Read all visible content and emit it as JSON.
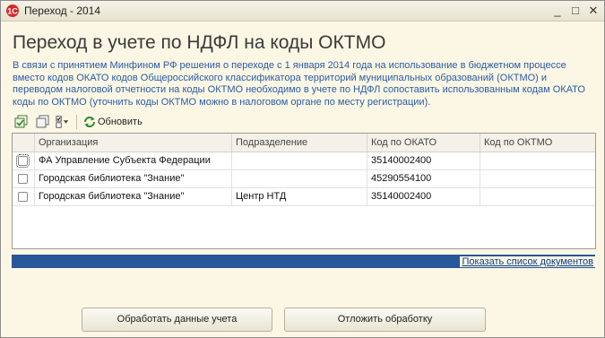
{
  "window": {
    "title": "Переход - 2014",
    "controls": {
      "minimize": "_",
      "maximize": "□",
      "close": "✕"
    }
  },
  "page": {
    "title": "Переход в учете по НДФЛ на коды ОКТМО",
    "info_lines": [
      "В связи с принятием Минфином РФ решения о переходе с 1 января 2014 года на использование в бюджетном процессе",
      "вместо кодов ОКАТО кодов Общероссийского классификатора территорий муниципальных образований (ОКТМО) и",
      "переводом налоговой отчетности на коды ОКТМО необходимо в учете по НДФЛ сопоставить использованным кодам ОКАТО",
      "коды по ОКТМО (уточнить коды ОКТМО можно в налоговом органе по месту регистрации)."
    ]
  },
  "toolbar": {
    "icons": [
      "select-all-icon",
      "deselect-all-icon",
      "checklist-menu-icon"
    ],
    "refresh_label": "Обновить"
  },
  "table": {
    "columns": [
      "",
      "Организация",
      "Подразделение",
      "Код по ОКАТО",
      "Код по ОКТМО"
    ],
    "rows": [
      {
        "checked": false,
        "organization": "ФА Управление Субъекта Федерации",
        "subdivision": "",
        "okato": "35140002400",
        "oktmo": ""
      },
      {
        "checked": false,
        "organization": "Городская библиотека \"Знание\"",
        "subdivision": "",
        "okato": "45290554100",
        "oktmo": ""
      },
      {
        "checked": false,
        "organization": "Городская библиотека \"Знание\"",
        "subdivision": "Центр НТД",
        "okato": "35140002400",
        "oktmo": ""
      }
    ]
  },
  "links": {
    "show_documents": "Показать список документов"
  },
  "buttons": {
    "process": "Обработать данные учета",
    "postpone": "Отложить обработку"
  },
  "colors": {
    "background": "#fbf7e4",
    "info_text": "#2a5ba8",
    "bar": "#27589a"
  }
}
